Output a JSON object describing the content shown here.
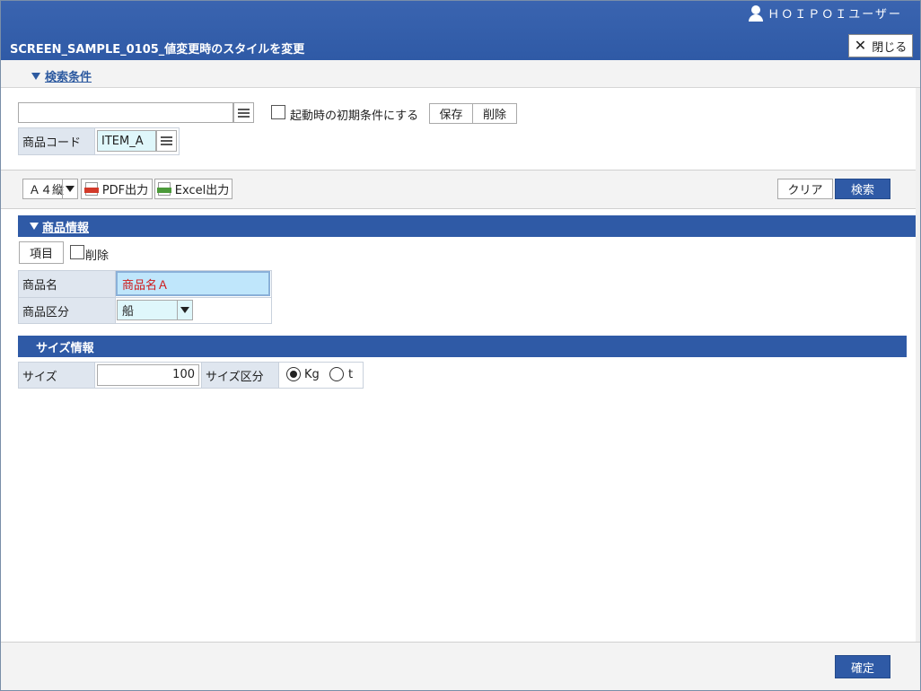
{
  "header": {
    "user_name": "ＨＯＩＰＯＩユーザー",
    "title": "SCREEN_SAMPLE_0105_値変更時のスタイルを変更",
    "close_label": "閉じる"
  },
  "search": {
    "toggle_label": "検索条件",
    "condition_value": "",
    "startup_checkbox_label": "起動時の初期条件にする",
    "startup_checked": false,
    "save_label": "保存",
    "delete_label": "削除",
    "product_code_label": "商品コード",
    "product_code_value": "ITEM_A"
  },
  "toolbar": {
    "paper_size": "Ａ４縦",
    "pdf_label": "PDF出力",
    "excel_label": "Excel出力",
    "clear_label": "クリア",
    "search_label": "検索"
  },
  "product_info": {
    "section_title": "商品情報",
    "item_button_label": "項目",
    "delete_checkbox_label": "削除",
    "delete_checked": false,
    "name_label": "商品名",
    "name_value": "商品名Ａ",
    "category_label": "商品区分",
    "category_value": "船"
  },
  "size_info": {
    "section_title": "サイズ情報",
    "size_label": "サイズ",
    "size_value": "100",
    "unit_label": "サイズ区分",
    "unit_options": [
      "Kg",
      "t"
    ],
    "unit_selected": "Kg"
  },
  "footer": {
    "confirm_label": "確定"
  },
  "colors": {
    "accent": "#2f5aa6",
    "label_bg": "#dfe6ef",
    "changed_bg": "#bfe6fb",
    "changed_text": "#d01818"
  }
}
